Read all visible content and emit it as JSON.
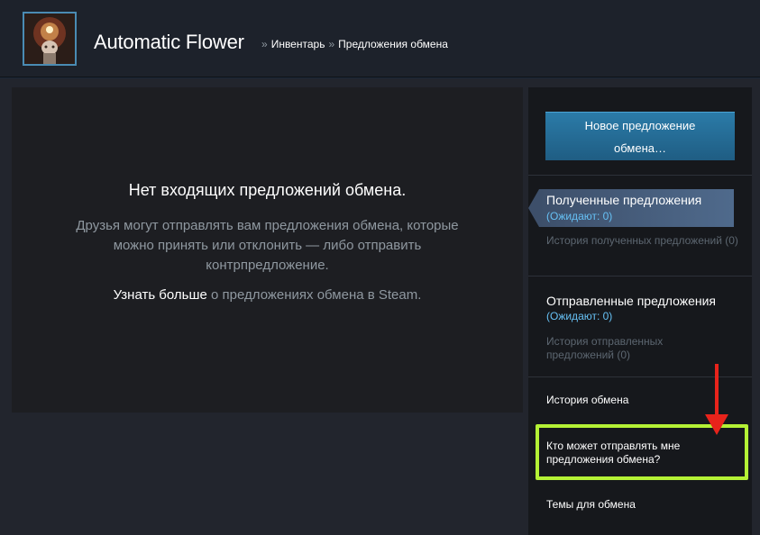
{
  "header": {
    "persona_name": "Automatic Flower",
    "breadcrumb_sep": "»",
    "breadcrumb_inventory": "Инвентарь",
    "breadcrumb_current": "Предложения обмена"
  },
  "main": {
    "empty_title": "Нет входящих предложений обмена.",
    "empty_desc": "Друзья могут отправлять вам предложения обмена, которые можно принять или отклонить — либо отправить контрпредложение.",
    "learn_more": "Узнать больше",
    "learn_more_rest": " о предложениях обмена в Steam."
  },
  "sidebar": {
    "new_offer_line1": "Новое предложение",
    "new_offer_line2": "обмена…",
    "received_title": "Полученные предложения",
    "received_pending": "(Ожидают: 0)",
    "received_history": "История полученных предложений (0)",
    "sent_title": "Отправленные предложения",
    "sent_pending": "(Ожидают: 0)",
    "sent_history": "История отправленных предложений (0)",
    "trade_history": "История обмена",
    "who_can_send": "Кто может отправлять мне предложения обмена?",
    "trade_topics": "Темы для обмена"
  },
  "colors": {
    "accent_blue": "#66c0f4",
    "highlight": "#b4f135",
    "arrow": "#e8231b"
  },
  "icons": {
    "avatar": "avatar-image",
    "arrow": "red-arrow-annotation"
  }
}
